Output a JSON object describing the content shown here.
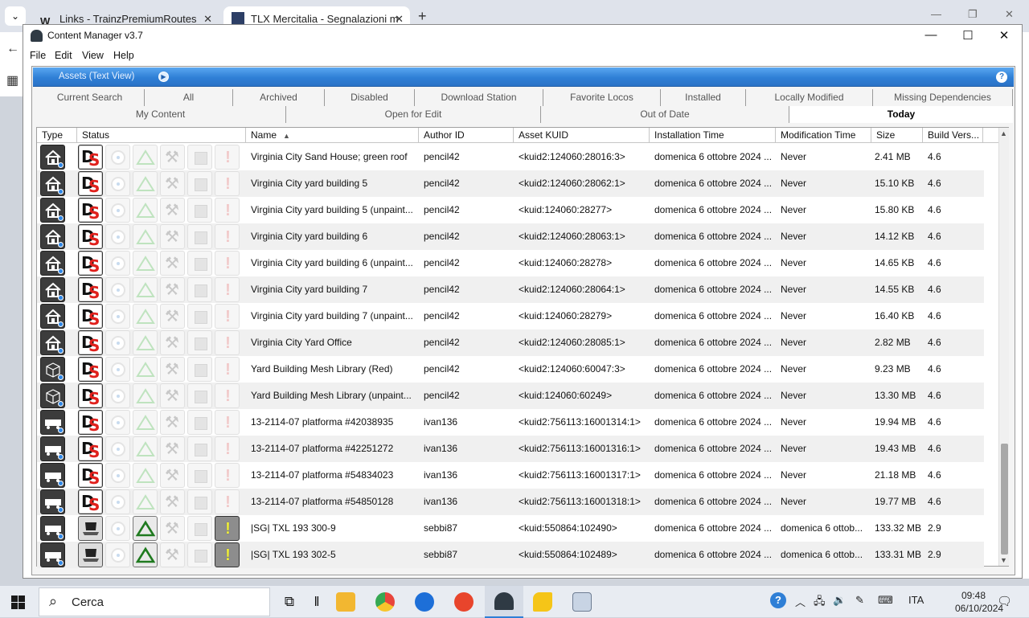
{
  "browser": {
    "tabs": [
      {
        "title": "Links - TrainzPremiumRoutes",
        "active": false
      },
      {
        "title": "TLX Mercitalia - Segnalazioni m",
        "active": true
      }
    ],
    "new_tab": "+",
    "down": "⌄"
  },
  "window": {
    "title": "Content Manager v3.7",
    "menus": [
      "File",
      "Edit",
      "View",
      "Help"
    ]
  },
  "panel": {
    "view_label": "Assets (Text View)",
    "help_glyph": "?",
    "filters_row1": [
      "Current Search",
      "All",
      "Archived",
      "Disabled",
      "Download Station",
      "Favorite Locos",
      "Installed",
      "Locally Modified",
      "Missing Dependencies"
    ],
    "filters_row2": [
      "My Content",
      "Open for Edit",
      "Out of Date",
      "Today"
    ],
    "active_filter": "Today"
  },
  "table": {
    "columns": [
      "Type",
      "Status",
      "Name",
      "Author ID",
      "Asset KUID",
      "Installation Time",
      "Modification Time",
      "Size",
      "Build Vers..."
    ],
    "sorted_column": "Name",
    "rows": [
      {
        "type": "house",
        "status": "ds",
        "name": "Virginia City Sand House; green roof",
        "author": "pencil42",
        "kuid": "<kuid2:124060:28016:3>",
        "installed": "domenica 6 ottobre 2024 ...",
        "modified": "Never",
        "size": "2.41 MB",
        "build": "4.6"
      },
      {
        "type": "house",
        "status": "ds",
        "name": "Virginia City yard building 5",
        "author": "pencil42",
        "kuid": "<kuid2:124060:28062:1>",
        "installed": "domenica 6 ottobre 2024 ...",
        "modified": "Never",
        "size": "15.10 KB",
        "build": "4.6"
      },
      {
        "type": "house",
        "status": "ds",
        "name": "Virginia City yard building 5 (unpaint...",
        "author": "pencil42",
        "kuid": "<kuid:124060:28277>",
        "installed": "domenica 6 ottobre 2024 ...",
        "modified": "Never",
        "size": "15.80 KB",
        "build": "4.6"
      },
      {
        "type": "house",
        "status": "ds",
        "name": "Virginia City yard building 6",
        "author": "pencil42",
        "kuid": "<kuid2:124060:28063:1>",
        "installed": "domenica 6 ottobre 2024 ...",
        "modified": "Never",
        "size": "14.12 KB",
        "build": "4.6"
      },
      {
        "type": "house",
        "status": "ds",
        "name": "Virginia City yard building 6 (unpaint...",
        "author": "pencil42",
        "kuid": "<kuid:124060:28278>",
        "installed": "domenica 6 ottobre 2024 ...",
        "modified": "Never",
        "size": "14.65 KB",
        "build": "4.6"
      },
      {
        "type": "house",
        "status": "ds",
        "name": "Virginia City yard building 7",
        "author": "pencil42",
        "kuid": "<kuid2:124060:28064:1>",
        "installed": "domenica 6 ottobre 2024 ...",
        "modified": "Never",
        "size": "14.55 KB",
        "build": "4.6"
      },
      {
        "type": "house",
        "status": "ds",
        "name": "Virginia City yard building 7 (unpaint...",
        "author": "pencil42",
        "kuid": "<kuid:124060:28279>",
        "installed": "domenica 6 ottobre 2024 ...",
        "modified": "Never",
        "size": "16.40 KB",
        "build": "4.6"
      },
      {
        "type": "house",
        "status": "ds",
        "name": "Virginia City Yard Office",
        "author": "pencil42",
        "kuid": "<kuid2:124060:28085:1>",
        "installed": "domenica 6 ottobre 2024 ...",
        "modified": "Never",
        "size": "2.82 MB",
        "build": "4.6"
      },
      {
        "type": "mesh",
        "status": "ds",
        "name": "Yard Building Mesh Library (Red)",
        "author": "pencil42",
        "kuid": "<kuid2:124060:60047:3>",
        "installed": "domenica 6 ottobre 2024 ...",
        "modified": "Never",
        "size": "9.23 MB",
        "build": "4.6"
      },
      {
        "type": "mesh",
        "status": "ds",
        "name": "Yard Building Mesh Library (unpaint...",
        "author": "pencil42",
        "kuid": "<kuid:124060:60249>",
        "installed": "domenica 6 ottobre 2024 ...",
        "modified": "Never",
        "size": "13.30 MB",
        "build": "4.6"
      },
      {
        "type": "wagon",
        "status": "ds",
        "name": "13-2114-07 platforma #42038935",
        "author": "ivan136",
        "kuid": "<kuid2:756113:16001314:1>",
        "installed": "domenica 6 ottobre 2024 ...",
        "modified": "Never",
        "size": "19.94 MB",
        "build": "4.6"
      },
      {
        "type": "wagon",
        "status": "ds",
        "name": "13-2114-07 platforma #42251272",
        "author": "ivan136",
        "kuid": "<kuid2:756113:16001316:1>",
        "installed": "domenica 6 ottobre 2024 ...",
        "modified": "Never",
        "size": "19.43 MB",
        "build": "4.6"
      },
      {
        "type": "wagon",
        "status": "ds",
        "name": "13-2114-07 platforma #54834023",
        "author": "ivan136",
        "kuid": "<kuid2:756113:16001317:1>",
        "installed": "domenica 6 ottobre 2024 ...",
        "modified": "Never",
        "size": "21.18 MB",
        "build": "4.6"
      },
      {
        "type": "wagon",
        "status": "ds",
        "name": "13-2114-07 platforma #54850128",
        "author": "ivan136",
        "kuid": "<kuid2:756113:16001318:1>",
        "installed": "domenica 6 ottobre 2024 ...",
        "modified": "Never",
        "size": "19.77 MB",
        "build": "4.6"
      },
      {
        "type": "wagon",
        "status": "local",
        "name": "|SG| TXL 193 300-9",
        "author": "sebbi87",
        "kuid": "<kuid:550864:102490>",
        "installed": "domenica 6 ottobre 2024 ...",
        "modified": "domenica 6 ottob...",
        "size": "133.32 MB",
        "build": "2.9"
      },
      {
        "type": "wagon",
        "status": "local",
        "name": "|SG| TXL 193 302-5",
        "author": "sebbi87",
        "kuid": "<kuid:550864:102489>",
        "installed": "domenica 6 ottobre 2024 ...",
        "modified": "domenica 6 ottob...",
        "size": "133.31 MB",
        "build": "2.9"
      }
    ]
  },
  "taskbar": {
    "search_placeholder": "Cerca",
    "language": "ITA",
    "time": "09:48",
    "date": "06/10/2024"
  },
  "colors": {
    "accent_blue": "#2f7fd6",
    "ds_red": "#e0201c",
    "warning_yellow": "#ecec3a",
    "tri_green": "#1f7a1f"
  }
}
